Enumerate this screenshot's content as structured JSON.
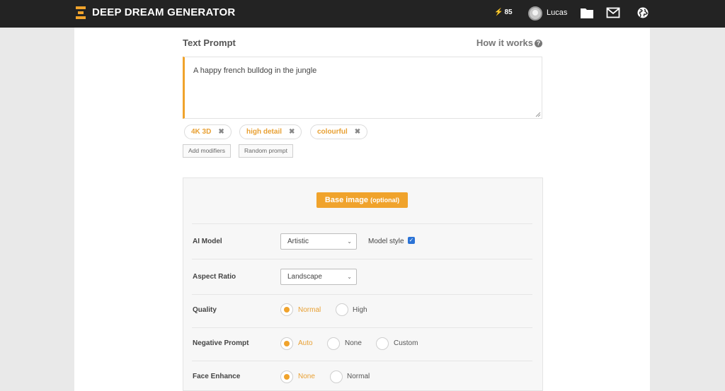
{
  "header": {
    "brand": "DEEP DREAM GENERATOR",
    "energy": "85",
    "username": "Lucas",
    "icons": [
      "logo-icon",
      "bolt-icon",
      "avatar",
      "folder-icon",
      "mail-icon",
      "globe-icon"
    ]
  },
  "prompt": {
    "title": "Text Prompt",
    "how_it_works": "How it works",
    "value": "A happy french bulldog in the jungle"
  },
  "modifiers": [
    {
      "label": "4K 3D"
    },
    {
      "label": "high detail"
    },
    {
      "label": "colourful"
    }
  ],
  "buttons": {
    "add_modifiers": "Add modifiers",
    "random_prompt": "Random prompt",
    "base_image": "Base image",
    "base_image_suffix": "(optional)"
  },
  "settings": {
    "ai_model": {
      "label": "AI Model",
      "value": "Artistic",
      "model_style_label": "Model style",
      "model_style_checked": true
    },
    "aspect_ratio": {
      "label": "Aspect Ratio",
      "value": "Landscape"
    },
    "quality": {
      "label": "Quality",
      "options": [
        "Normal",
        "High"
      ],
      "selected": "Normal"
    },
    "negative_prompt": {
      "label": "Negative Prompt",
      "options": [
        "Auto",
        "None",
        "Custom"
      ],
      "selected": "Auto"
    },
    "face_enhance": {
      "label": "Face Enhance",
      "options": [
        "None",
        "Normal"
      ],
      "selected": "None"
    }
  },
  "colors": {
    "accent": "#f0a32c",
    "topbar": "#232323",
    "checkbox": "#2b73d6"
  }
}
